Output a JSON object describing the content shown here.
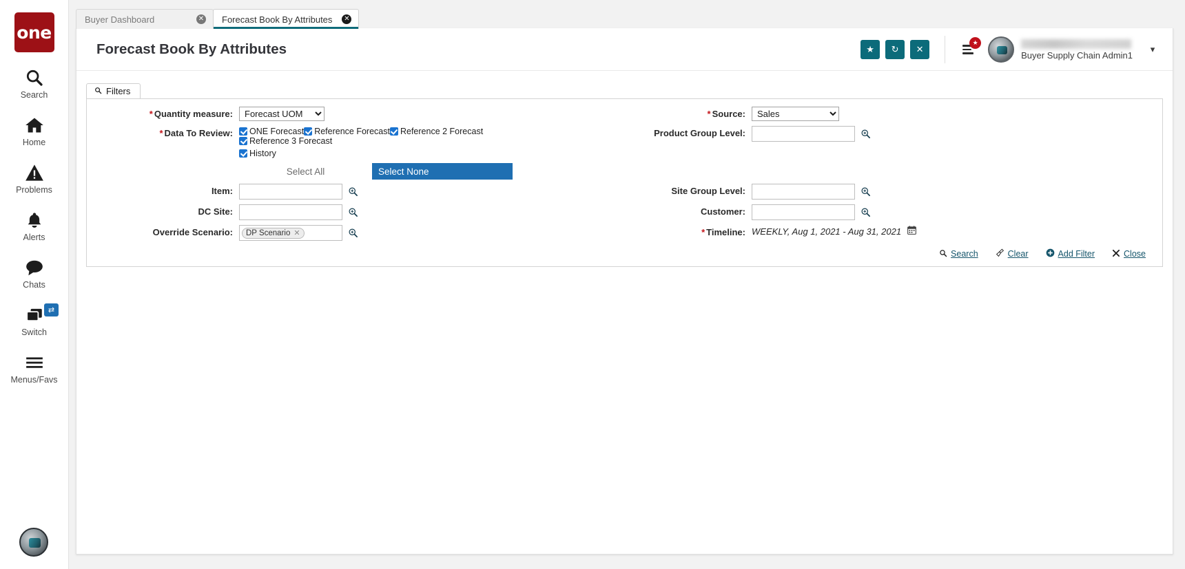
{
  "rail": {
    "logo_text": "one",
    "items": [
      {
        "label": "Search",
        "icon": "search-icon"
      },
      {
        "label": "Home",
        "icon": "home-icon"
      },
      {
        "label": "Problems",
        "icon": "warning-icon"
      },
      {
        "label": "Alerts",
        "icon": "bell-icon"
      },
      {
        "label": "Chats",
        "icon": "chat-icon"
      },
      {
        "label": "Switch",
        "icon": "switch-icon",
        "badge": "⇄"
      },
      {
        "label": "Menus/Favs",
        "icon": "hamburger-icon"
      }
    ]
  },
  "tabs": [
    {
      "label": "Buyer Dashboard",
      "active": false,
      "close": "✕"
    },
    {
      "label": "Forecast Book By Attributes",
      "active": true,
      "close": "✕"
    }
  ],
  "header": {
    "title": "Forecast Book By Attributes",
    "buttons": [
      {
        "name": "favorite-button",
        "glyph": "★"
      },
      {
        "name": "refresh-button",
        "glyph": "↻"
      },
      {
        "name": "close-page-button",
        "glyph": "✕"
      }
    ],
    "menu_badge": "★",
    "user_role": "Buyer Supply Chain Admin1",
    "caret": "▾",
    "accent_color": "#0c6b7a",
    "badge_color": "#c0111b"
  },
  "filters": {
    "tab_label": "Filters",
    "tab_icon": "search-icon",
    "quantity_measure": {
      "label": "Quantity measure:",
      "required": "*",
      "value": "Forecast UOM",
      "options": [
        "Forecast UOM"
      ]
    },
    "source": {
      "label": "Source:",
      "required": "*",
      "value": "Sales",
      "options": [
        "Sales"
      ]
    },
    "data_to_review": {
      "label": "Data To Review:",
      "required": "*",
      "checkboxes": [
        {
          "label": "ONE Forecast",
          "checked": true
        },
        {
          "label": "Reference Forecast",
          "checked": true
        },
        {
          "label": "Reference 2 Forecast",
          "checked": true
        },
        {
          "label": "Reference 3 Forecast",
          "checked": true
        },
        {
          "label": "History",
          "checked": true
        }
      ]
    },
    "product_group_level": {
      "label": "Product Group Level:",
      "value": "",
      "placeholder": ""
    },
    "select_all_label": "Select All",
    "select_none_label": "Select None",
    "select_none_color": "#1f6fb2",
    "item": {
      "label": "Item:",
      "value": "",
      "placeholder": ""
    },
    "dc_site": {
      "label": "DC Site:",
      "value": "",
      "placeholder": ""
    },
    "site_group_level": {
      "label": "Site Group Level:",
      "value": "",
      "placeholder": ""
    },
    "customer": {
      "label": "Customer:",
      "value": "",
      "placeholder": ""
    },
    "override_scenario": {
      "label": "Override Scenario:",
      "chips": [
        {
          "label": "DP Scenario",
          "remove": "✕"
        }
      ]
    },
    "timeline": {
      "label": "Timeline:",
      "required": "*",
      "value": "WEEKLY, Aug 1, 2021 - Aug 31, 2021"
    },
    "actions": [
      {
        "name": "search-action",
        "label": "Search",
        "icon": "search-icon"
      },
      {
        "name": "clear-action",
        "label": "Clear",
        "icon": "broom-icon"
      },
      {
        "name": "add-filter-action",
        "label": "Add Filter",
        "icon": "plus-circle-icon"
      },
      {
        "name": "close-action",
        "label": "Close",
        "icon": "close-icon"
      }
    ]
  }
}
